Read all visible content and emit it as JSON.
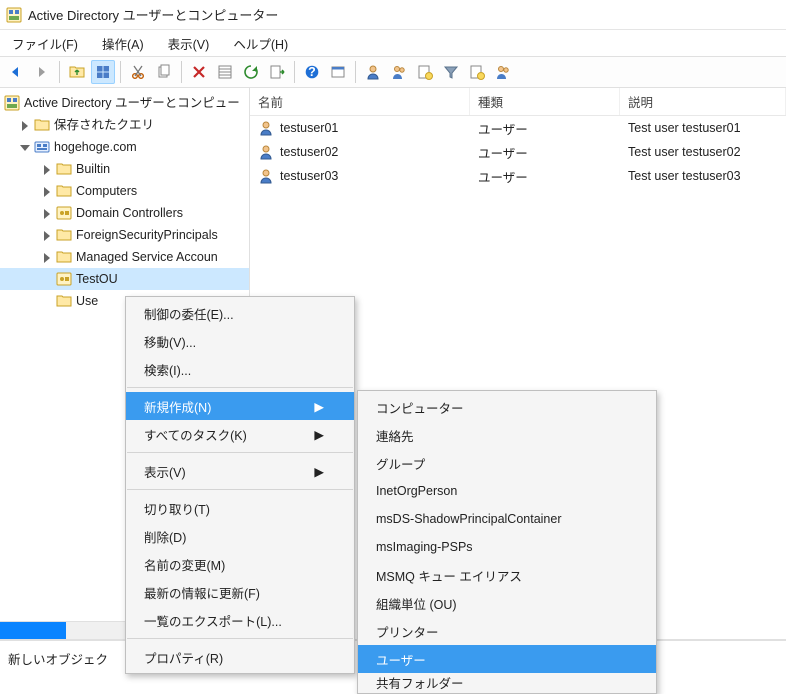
{
  "window": {
    "title": "Active Directory ユーザーとコンピューター"
  },
  "menus": {
    "file": "ファイル(F)",
    "action": "操作(A)",
    "view": "表示(V)",
    "help": "ヘルプ(H)"
  },
  "tree": {
    "root": "Active Directory ユーザーとコンピュー",
    "savedQueries": "保存されたクエリ",
    "domain": "hogehoge.com",
    "builtin": "Builtin",
    "computers": "Computers",
    "dc": "Domain Controllers",
    "fsp": "ForeignSecurityPrincipals",
    "msa": "Managed Service Accoun",
    "testou": "TestOU",
    "users": "Use"
  },
  "columns": {
    "name": "名前",
    "type": "種類",
    "desc": "説明"
  },
  "rows": [
    {
      "name": "testuser01",
      "type": "ユーザー",
      "desc": "Test user testuser01"
    },
    {
      "name": "testuser02",
      "type": "ユーザー",
      "desc": "Test user testuser02"
    },
    {
      "name": "testuser03",
      "type": "ユーザー",
      "desc": "Test user testuser03"
    }
  ],
  "ctx1": {
    "delegate": "制御の委任(E)...",
    "move": "移動(V)...",
    "find": "検索(I)...",
    "new": "新規作成(N)",
    "alltasks": "すべてのタスク(K)",
    "view": "表示(V)",
    "cut": "切り取り(T)",
    "delete": "削除(D)",
    "rename": "名前の変更(M)",
    "refresh": "最新の情報に更新(F)",
    "export": "一覧のエクスポート(L)...",
    "properties": "プロパティ(R)"
  },
  "ctx2": {
    "computer": "コンピューター",
    "contact": "連絡先",
    "group": "グループ",
    "inetorg": "InetOrgPerson",
    "msds": "msDS-ShadowPrincipalContainer",
    "msimg": "msImaging-PSPs",
    "msmq": "MSMQ キュー エイリアス",
    "ou": "組織単位 (OU)",
    "printer": "プリンター",
    "user": "ユーザー",
    "shared": "共有フォルダー"
  },
  "status": {
    "text": "新しいオブジェク"
  }
}
